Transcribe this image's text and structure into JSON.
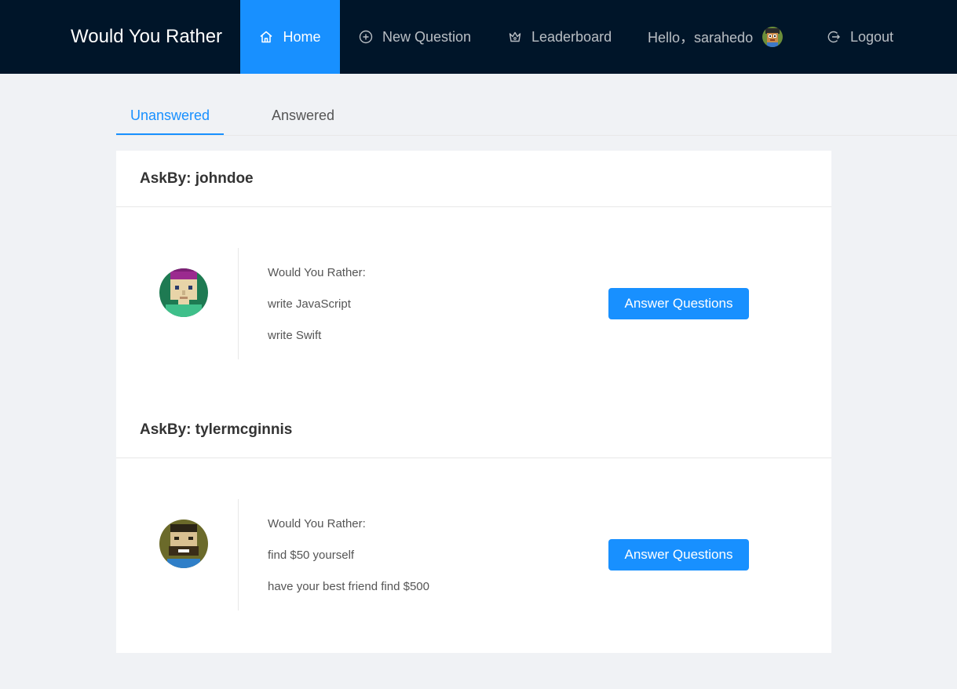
{
  "app": {
    "title": "Would You Rather"
  },
  "nav": {
    "home": "Home",
    "new_question": "New Question",
    "leaderboard": "Leaderboard",
    "greeting": "Hello，sarahedo",
    "logout": "Logout"
  },
  "tabs": {
    "unanswered": "Unanswered",
    "answered": "Answered"
  },
  "questions": [
    {
      "asked_by": "AskBy: johndoe",
      "prompt": "Would You Rather:",
      "option_one": "write JavaScript",
      "option_two": "write Swift",
      "button": "Answer Questions"
    },
    {
      "asked_by": "AskBy: tylermcginnis",
      "prompt": "Would You Rather:",
      "option_one": "find $50 yourself",
      "option_two": "have your best friend find $500",
      "button": "Answer Questions"
    }
  ],
  "colors": {
    "header_bg": "#001529",
    "accent": "#1890ff",
    "page_bg": "#f0f2f5"
  }
}
